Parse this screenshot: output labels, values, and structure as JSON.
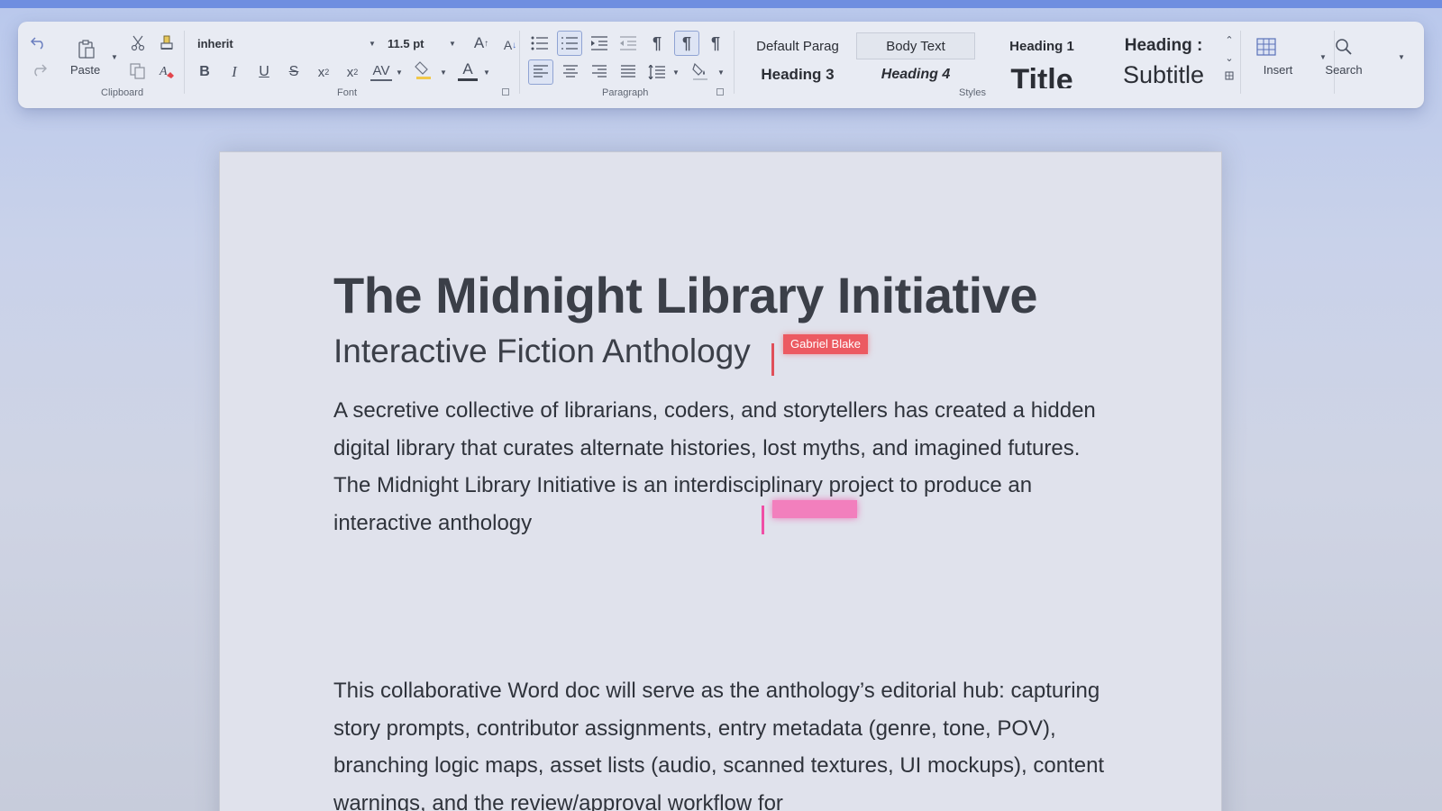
{
  "ribbon": {
    "clipboard": {
      "label": "Clipboard",
      "paste_label": "Paste"
    },
    "font": {
      "label": "Font",
      "font_name": "inherit",
      "font_size": "11.5 pt",
      "spacing_glyph": "AV",
      "color_glyph": "A"
    },
    "paragraph": {
      "label": "Paragraph"
    },
    "styles": {
      "label": "Styles",
      "items": [
        "Default Parag",
        "Body Text",
        "Heading 1",
        "Heading :",
        "Heading 3",
        "Heading 4",
        "Title",
        "Subtitle"
      ]
    },
    "insert_label": "Insert",
    "search_label": "Search"
  },
  "document": {
    "title": "The Midnight Library Initiative",
    "subtitle": "Interactive Fiction Anthology",
    "paragraph1": "A secretive collective of librarians, coders, and storytellers has created a hidden digital library that curates alternate histories, lost myths, and imagined futures. The Midnight Library Initiative is an interdisciplinary project to produce an interactive anthology",
    "paragraph2": "This collaborative Word doc will serve as the anthology’s editorial hub: capturing story prompts, contributor assignments, entry metadata (genre, tone, POV), branching logic maps, asset lists (audio, scanned textures, UI mockups), content warnings, and the review/approval workflow for"
  },
  "collaborators": {
    "red_cursor_name": "Gabriel Blake",
    "red_color": "#ec5a61",
    "pink_color": "#f04fa6"
  }
}
